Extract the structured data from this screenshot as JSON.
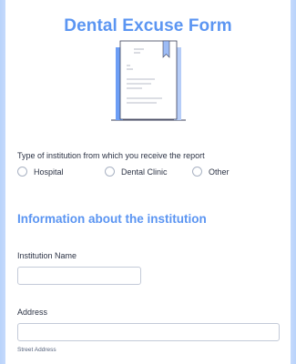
{
  "form": {
    "title": "Dental Excuse Form",
    "question": "Type of institution from which you receive the report",
    "options": [
      "Hospital",
      "Dental Clinic",
      "Other"
    ],
    "section_heading": "Information about the institution",
    "institution_name_label": "Institution Name",
    "address_label": "Address",
    "street_address_sublabel": "Street Address"
  },
  "colors": {
    "accent": "#5b95f2",
    "text": "#2c3345",
    "border": "#c3cad8"
  },
  "icons": {
    "illustration": "document-illustration"
  }
}
